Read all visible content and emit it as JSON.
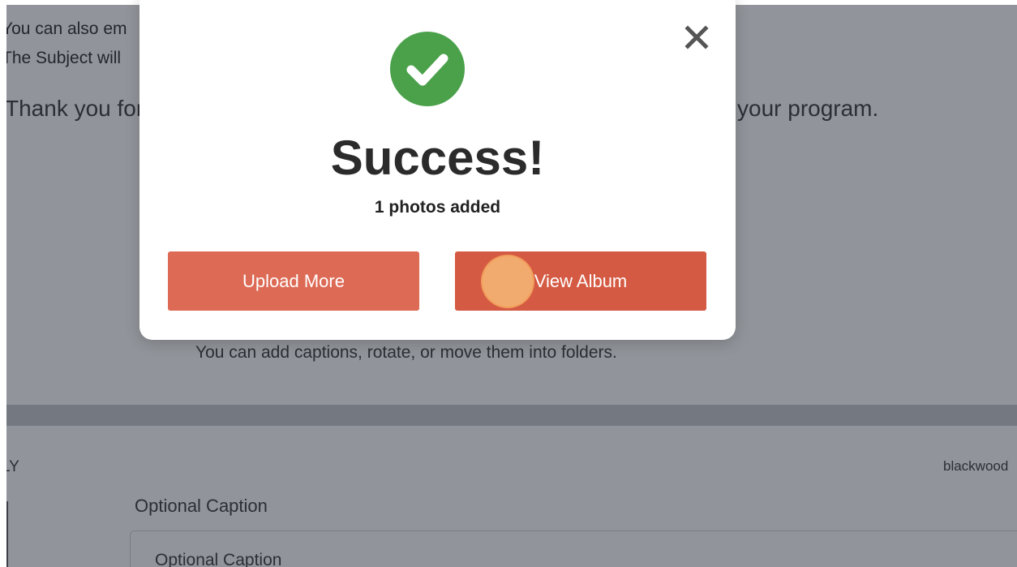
{
  "background": {
    "line1": "You can also em",
    "line2": "The Subject will",
    "line3_left": "Thank you for",
    "line3_right": "your program.",
    "mid_text": "You can add captions, rotate, or move them into folders.",
    "label_left": "LY",
    "label_right": "blackwood",
    "caption_label": "Optional Caption",
    "caption_input_value": "Optional Caption"
  },
  "modal": {
    "close_icon": "close-icon",
    "status_icon": "check-circle-icon",
    "title": "Success!",
    "subtitle": "1 photos added",
    "upload_more_label": "Upload More",
    "view_album_label": "View Album"
  },
  "colors": {
    "success_green": "#4aa14a",
    "button_upload": "#dd6a55",
    "button_view": "#d55a43",
    "click_indicator": "#f4b272"
  }
}
